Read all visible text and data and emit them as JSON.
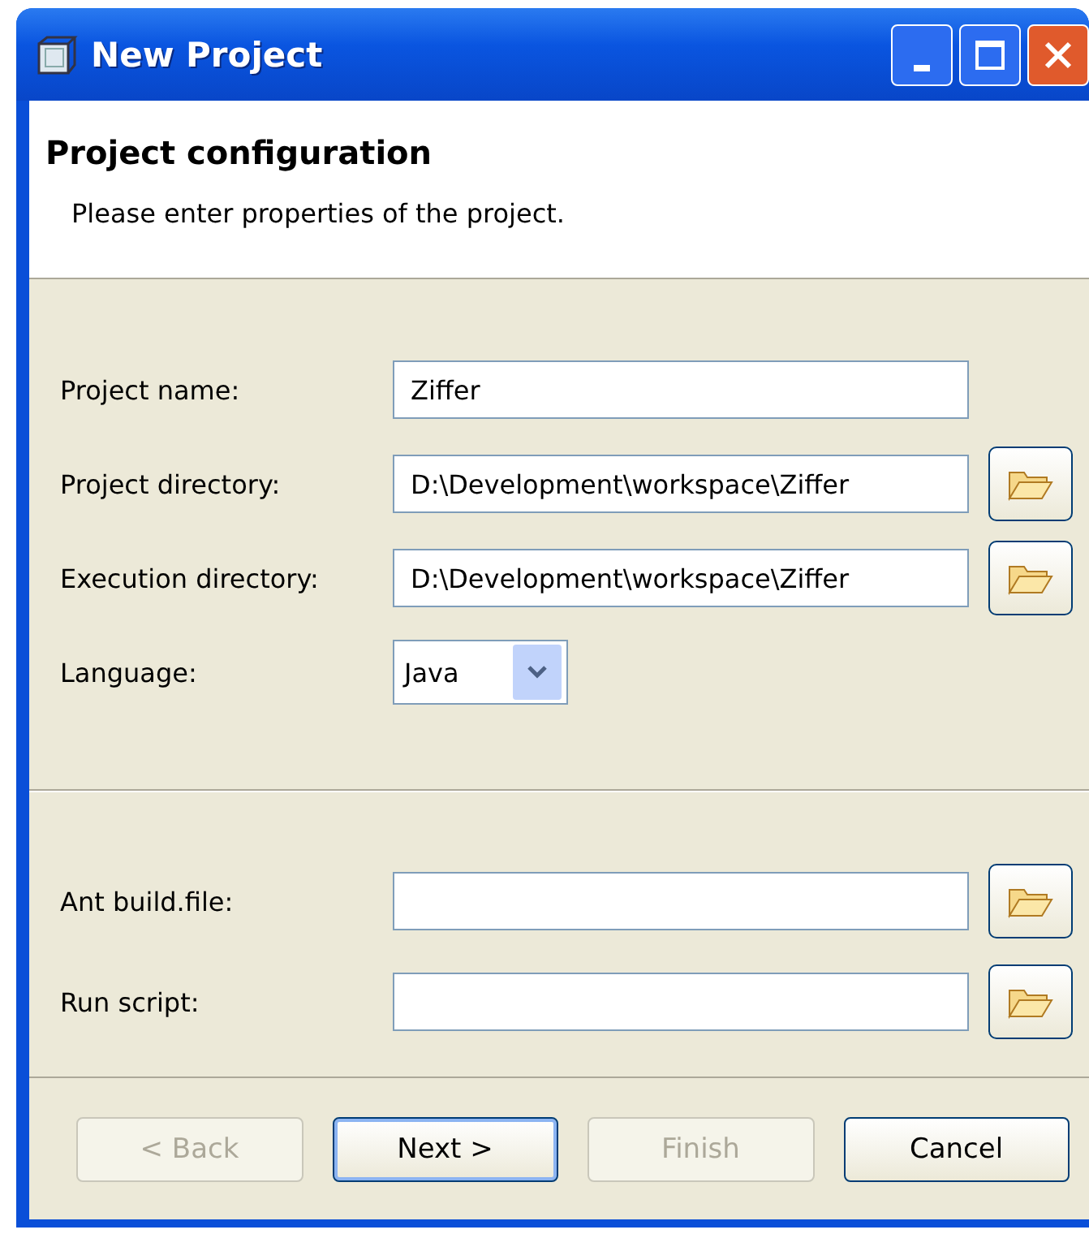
{
  "window": {
    "title": "New Project"
  },
  "header": {
    "title": "Project configuration",
    "description": "Please enter properties of the project."
  },
  "fields": [
    {
      "kind": "text",
      "label": "Project name:",
      "value": "Ziffer"
    },
    {
      "kind": "browse",
      "label": "Project directory:",
      "value": "D:\\Development\\workspace\\Ziffer"
    },
    {
      "kind": "browse",
      "label": "Execution directory:",
      "value": "D:\\Development\\workspace\\Ziffer"
    },
    {
      "kind": "select",
      "label": "Language:",
      "value": "Java"
    }
  ],
  "build_fields": [
    {
      "kind": "browse",
      "label": "Ant build.file:"
    },
    {
      "kind": "browse",
      "label": "Run script:"
    }
  ],
  "buttons": [
    {
      "label": "< Back",
      "disabled": true,
      "default": false
    },
    {
      "label": "Next >",
      "disabled": false,
      "default": true
    },
    {
      "label": "Finish",
      "disabled": true,
      "default": false
    },
    {
      "label": "Cancel",
      "disabled": false,
      "default": false
    }
  ]
}
